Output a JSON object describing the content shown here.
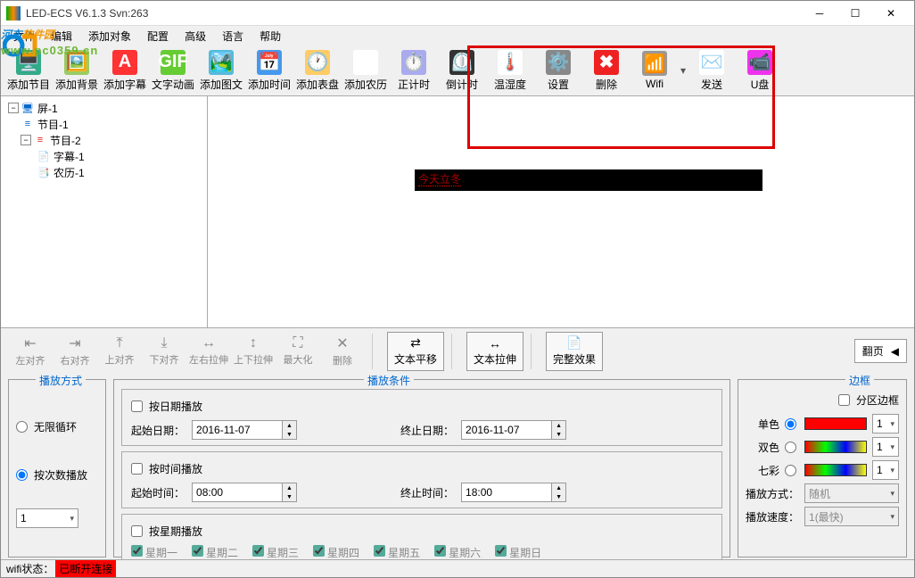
{
  "window": {
    "title": "LED-ECS V6.1.3 Svn:263"
  },
  "watermark": {
    "text1a": "河东",
    "text1b": "软件园",
    "url": "www.pc0359.cn"
  },
  "menu": {
    "items": [
      "文件",
      "编辑",
      "添加对象",
      "配置",
      "高级",
      "语言",
      "帮助"
    ]
  },
  "toolbar": [
    {
      "label": "添加节目",
      "icon": "🖥️",
      "bg": "#3a8"
    },
    {
      "label": "添加背景",
      "icon": "🖼️",
      "bg": "#9c6"
    },
    {
      "label": "添加字幕",
      "icon": "A",
      "bg": "#f33"
    },
    {
      "label": "文字动画",
      "icon": "GIF",
      "bg": "#6c3"
    },
    {
      "label": "添加图文",
      "icon": "🏞️",
      "bg": "#5bd"
    },
    {
      "label": "添加时间",
      "icon": "📅",
      "bg": "#49e"
    },
    {
      "label": "添加表盘",
      "icon": "🕐",
      "bg": "#fc6"
    },
    {
      "label": "添加农历",
      "icon": "10",
      "bg": "#fff"
    },
    {
      "label": "正计时",
      "icon": "⏱️",
      "bg": "#aae"
    },
    {
      "label": "倒计时",
      "icon": "⏲️",
      "bg": "#333"
    },
    {
      "label": "温湿度",
      "icon": "🌡️",
      "bg": "#fff"
    },
    {
      "label": "设置",
      "icon": "⚙️",
      "bg": "#888"
    },
    {
      "label": "删除",
      "icon": "✖",
      "bg": "#e22"
    },
    {
      "label": "Wifi",
      "icon": "📶",
      "bg": "#999"
    },
    {
      "label": "发送",
      "icon": "✉️",
      "bg": "#fff"
    },
    {
      "label": "U盘",
      "icon": "📹",
      "bg": "#e3e"
    }
  ],
  "tree": {
    "root": {
      "label": "屏-1",
      "icon": "🖥️"
    },
    "items": [
      {
        "label": "节目-1",
        "icon": "≡",
        "level": 1,
        "color": "#06c"
      },
      {
        "label": "节目-2",
        "icon": "≡",
        "level": 1,
        "color": "#d22"
      },
      {
        "label": "字幕-1",
        "icon": "📄",
        "level": 2,
        "color": "#d99"
      },
      {
        "label": "农历-1",
        "icon": "📑",
        "level": 2,
        "color": "#4a4"
      }
    ]
  },
  "preview": {
    "text": "今天立冬"
  },
  "align": {
    "buttons": [
      "左对齐",
      "右对齐",
      "上对齐",
      "下对齐",
      "左右拉伸",
      "上下拉伸",
      "最大化",
      "删除"
    ],
    "textbtns": [
      "文本平移",
      "文本拉伸",
      "完整效果"
    ],
    "flip": "翻页"
  },
  "playMode": {
    "legend": "播放方式",
    "opt1": "无限循环",
    "opt2": "按次数播放",
    "count": "1"
  },
  "playCond": {
    "legend": "播放条件",
    "byDate": "按日期播放",
    "startDate": {
      "label": "起始日期：",
      "value": "2016-11-07"
    },
    "endDate": {
      "label": "终止日期：",
      "value": "2016-11-07"
    },
    "byTime": "按时间播放",
    "startTime": {
      "label": "起始时间：",
      "value": "08:00"
    },
    "endTime": {
      "label": "终止时间：",
      "value": "18:00"
    },
    "byWeek": "按星期播放",
    "weekdays": [
      "星期一",
      "星期二",
      "星期三",
      "星期四",
      "星期五",
      "星期六",
      "星期日"
    ]
  },
  "border": {
    "legend": "边框",
    "partition": "分区边框",
    "single": "单色",
    "double": "双色",
    "rainbow": "七彩",
    "num1": "1",
    "num2": "1",
    "num3": "1",
    "playStyle": {
      "label": "播放方式：",
      "value": "随机"
    },
    "playSpeed": {
      "label": "播放速度：",
      "value": "1(最快)"
    }
  },
  "status": {
    "label": "wifi状态：",
    "value": "已断开连接"
  }
}
